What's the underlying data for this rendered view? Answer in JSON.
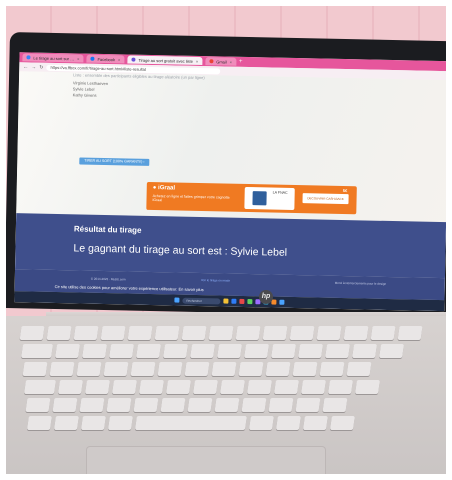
{
  "browser": {
    "tabs": [
      {
        "label": "Le tirage au sort sur …",
        "active": false,
        "favicon_color": "#3b82f6"
      },
      {
        "label": "Facebook",
        "active": false,
        "favicon_color": "#1877f2"
      },
      {
        "label": "Tirage au sort gratuit avec liste",
        "active": true,
        "favicon_color": "#6b4fd8"
      },
      {
        "label": "Gmail",
        "active": false,
        "favicon_color": "#ea4335"
      }
    ],
    "new_tab": "+",
    "url": "https://va.ffbox.com/fr/tirage-au-sort.html#liste-resultat"
  },
  "page": {
    "intro": "Liste : ensemble des participants éligibles au tirage aléatoire (un par ligne)",
    "participants": [
      "Virginie Lesthaeven",
      "Sylvie Lebel",
      "Kathy Givens"
    ],
    "draw_button": "TIRER AU SORT (100% GARANTI!) ›",
    "ad": {
      "brand": "● iGraal",
      "text": "Achetez en ligne et faites grimper votre cagnotte iGraal",
      "price": "LA FNAC",
      "cta": "DECOUVRIR CASH-BACK",
      "badge": "5€"
    },
    "result_title": "Résultat du tirage",
    "result_text": "Le gagnant du tirage au sort est : Sylvie Lebel",
    "footer_copy": "© 2014-2023 · MyBiz.com",
    "footer_link": "Voir le tirage en mode",
    "footer_right": "Merci à Remerciements pour le design",
    "cookie_notice": "Ce site utilise des cookies pour améliorer votre expérience utilisateur. En savoir plus"
  },
  "taskbar": {
    "search": "Rechercher",
    "icon_colors": [
      "#4aa3ff",
      "#f3c136",
      "#2f7cf6",
      "#e64848",
      "#5dd05d",
      "#9b6bff",
      "#3cc0e6",
      "#f58a2c"
    ]
  },
  "laptop": {
    "logo": "hp"
  },
  "keyboard": {
    "rows": [
      [
        "",
        "",
        "",
        "",
        "",
        "",
        "",
        "",
        "",
        "",
        "",
        "",
        "",
        "",
        ""
      ],
      [
        "",
        "",
        "",
        "",
        "",
        "",
        "",
        "",
        "",
        "",
        "",
        "",
        "",
        ""
      ],
      [
        "",
        "",
        "",
        "",
        "",
        "",
        "",
        "",
        "",
        "",
        "",
        "",
        ""
      ],
      [
        "",
        "",
        "",
        "",
        "",
        "",
        "",
        "",
        "",
        "",
        "",
        "",
        ""
      ],
      [
        "",
        "",
        "",
        "",
        "",
        "",
        "",
        "",
        "",
        "",
        "",
        ""
      ],
      [
        "",
        "",
        "",
        "",
        "",
        "",
        "",
        "",
        ""
      ]
    ]
  }
}
